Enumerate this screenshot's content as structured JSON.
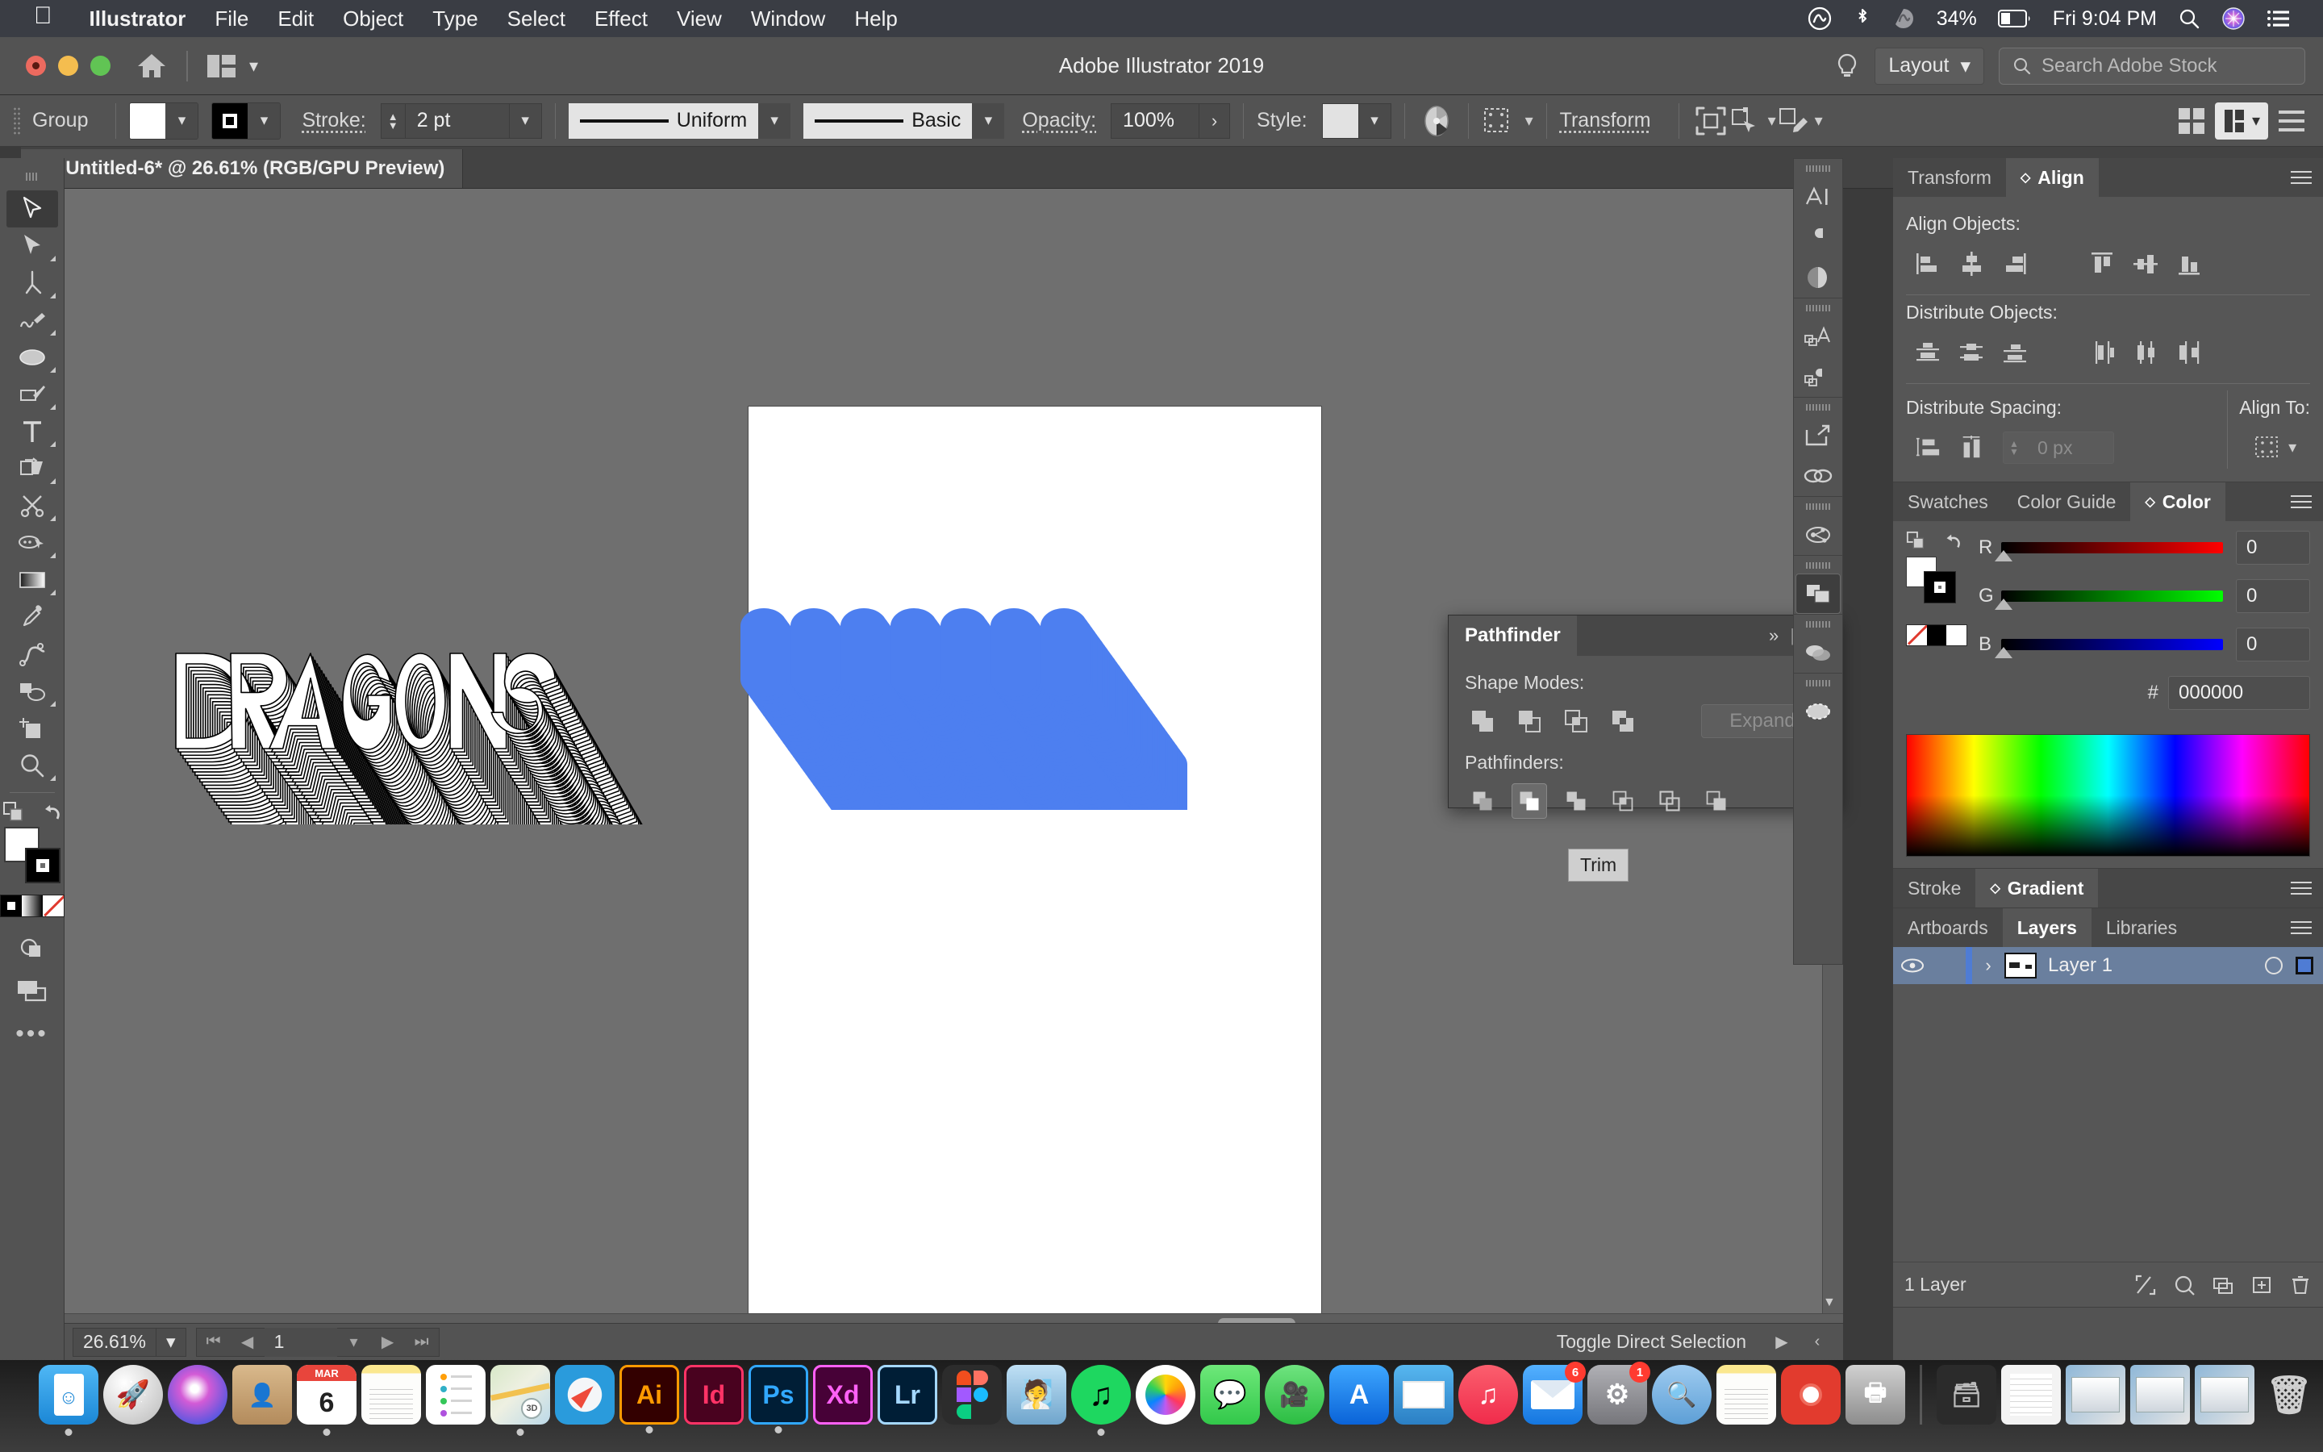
{
  "menubar": {
    "apple_icon": "apple-logo",
    "items": [
      "Illustrator",
      "File",
      "Edit",
      "Object",
      "Type",
      "Select",
      "Effect",
      "View",
      "Window",
      "Help"
    ],
    "status": {
      "creative_cloud_icon": "creative-cloud-icon",
      "bluetooth_icon": "bluetooth-icon",
      "dropbox_icon": "dropbox-icon",
      "battery_percent": "34%",
      "battery_icon": "battery-icon",
      "clock": "Fri 9:04 PM",
      "spotlight_icon": "search-icon",
      "siri_icon": "siri-icon",
      "control_center_icon": "list-icon"
    }
  },
  "titlebar": {
    "title": "Adobe Illustrator 2019",
    "home_icon": "home-icon",
    "arrange_icon": "arrange-documents-icon",
    "bulb_icon": "lightbulb-icon",
    "workspace": "Layout",
    "search_placeholder": "Search Adobe Stock",
    "search_icon": "search-icon"
  },
  "controlbar": {
    "selection_type": "Group",
    "fill_label": "fill-swatch",
    "stroke_label": "stroke-swatch",
    "stroke_text": "Stroke:",
    "stroke_weight": "2 pt",
    "variable_width_profile": "Uniform",
    "brush_definition": "Basic",
    "opacity_label": "Opacity:",
    "opacity_value": "100%",
    "style_label": "Style:",
    "recolor_icon": "recolor-artwork-icon",
    "align_icon": "align-icon",
    "transform_label": "Transform",
    "isolate_icon": "isolate-group-icon",
    "select_similar_icon": "select-similar-icon",
    "edit_toolbar_icon": "edit-toolbar-icon",
    "arrange_docs_icon": "arrange-documents-icon",
    "properties_icon": "properties-icon"
  },
  "documenttab": {
    "close": "×",
    "title": "Untitled-6* @ 26.61% (RGB/GPU Preview)"
  },
  "toolbar": {
    "tools": [
      {
        "name": "selection-tool",
        "active": true
      },
      {
        "name": "direct-selection-tool",
        "active": false
      },
      {
        "name": "pen-tool",
        "active": false
      },
      {
        "name": "curvature-tool",
        "active": false
      },
      {
        "name": "ellipse-tool",
        "active": false
      },
      {
        "name": "paintbrush-tool",
        "active": false
      },
      {
        "name": "type-tool",
        "active": false
      },
      {
        "name": "shape-builder-tool",
        "active": false
      },
      {
        "name": "scissors-tool",
        "active": false
      },
      {
        "name": "width-tool",
        "active": false
      },
      {
        "name": "gradient-tool",
        "active": false
      },
      {
        "name": "eyedropper-tool",
        "active": false
      },
      {
        "name": "blend-tool",
        "active": false
      },
      {
        "name": "symbol-sprayer-tool",
        "active": false
      },
      {
        "name": "artboard-tool",
        "active": false
      },
      {
        "name": "zoom-tool",
        "active": false
      }
    ],
    "swap_fill_stroke_icon": "swap-fill-stroke-icon",
    "default_colors_icon": "default-fill-stroke-icon",
    "color_modes": [
      "color-mode-icon",
      "gradient-mode-icon",
      "none-mode-icon"
    ],
    "drawing_mode_icon": "drawing-mode-icon",
    "screen_mode_icon": "screen-mode-icon",
    "more_tools_icon": "more-tools-icon"
  },
  "pathfinder": {
    "tab": "Pathfinder",
    "collapse_icon": "expand-panel-icon",
    "menu_icon": "panel-menu-icon",
    "shape_modes_label": "Shape Modes:",
    "shape_modes": [
      "unite-icon",
      "minus-front-icon",
      "intersect-icon",
      "exclude-icon"
    ],
    "expand_button": "Expand",
    "pathfinders_label": "Pathfinders:",
    "pathfinders": [
      "divide-icon",
      "trim-icon",
      "merge-icon",
      "crop-icon",
      "outline-icon",
      "minus-back-icon"
    ],
    "selected_pathfinder_index": 1,
    "tooltip": "Trim"
  },
  "icondock": {
    "groups": [
      [
        "character-panel-icon",
        "paragraph-panel-icon",
        "opacity-panel-icon"
      ],
      [
        "character-styles-icon",
        "paragraph-styles-icon"
      ],
      [
        "asset-export-icon",
        "links-panel-icon"
      ],
      [
        "symbols-panel-icon"
      ],
      [
        "pathfinder-panel-icon"
      ],
      [
        "transparency-panel-icon"
      ],
      [
        "image-trace-icon"
      ]
    ],
    "active_icon": "pathfinder-panel-icon"
  },
  "align_panel": {
    "tabs": [
      {
        "label": "Transform",
        "active": false,
        "modified": false
      },
      {
        "label": "Align",
        "active": true,
        "modified": true
      }
    ],
    "align_objects_label": "Align Objects:",
    "align_objects": [
      "align-left-icon",
      "align-horizontal-center-icon",
      "align-right-icon",
      "align-top-icon",
      "align-vertical-center-icon",
      "align-bottom-icon"
    ],
    "distribute_objects_label": "Distribute Objects:",
    "distribute_objects": [
      "distribute-vertical-top-icon",
      "distribute-vertical-center-icon",
      "distribute-vertical-bottom-icon",
      "distribute-horizontal-left-icon",
      "distribute-horizontal-center-icon",
      "distribute-horizontal-right-icon"
    ],
    "distribute_spacing_label": "Distribute Spacing:",
    "distribute_spacing": [
      "distribute-vertical-space-icon",
      "distribute-horizontal-space-icon"
    ],
    "spacing_value": "0 px",
    "align_to_label": "Align To:",
    "align_to_icon": "align-to-selection-icon"
  },
  "color_panel": {
    "tabs": [
      {
        "label": "Swatches",
        "active": false,
        "modified": false
      },
      {
        "label": "Color Guide",
        "active": false,
        "modified": false
      },
      {
        "label": "Color",
        "active": true,
        "modified": true
      }
    ],
    "sliders": [
      {
        "label": "R",
        "value": "0"
      },
      {
        "label": "G",
        "value": "0"
      },
      {
        "label": "B",
        "value": "0"
      }
    ],
    "hex_symbol": "#",
    "hex_value": "000000",
    "swap_icon": "swap-fill-stroke-icon",
    "revert_icon": "revert-arrow-icon"
  },
  "gradient_panel": {
    "tabs": [
      {
        "label": "Stroke",
        "active": false,
        "modified": false
      },
      {
        "label": "Gradient",
        "active": true,
        "modified": true
      }
    ]
  },
  "layers_panel": {
    "tabs": [
      {
        "label": "Artboards",
        "active": false
      },
      {
        "label": "Layers",
        "active": true
      },
      {
        "label": "Libraries",
        "active": false
      }
    ],
    "rows": [
      {
        "eye_icon": "eye-icon",
        "expand_icon": "chevron-right-icon",
        "thumbnail": "layer-thumbnail",
        "name": "Layer 1",
        "target_icon": "target-circle-icon",
        "selected_indicator": "selection-square"
      }
    ],
    "footer_label": "1 Layer",
    "footer_icons": [
      "locate-object-icon",
      "make-clipping-mask-icon",
      "create-sublayer-icon",
      "create-new-layer-icon",
      "delete-selection-icon"
    ]
  },
  "statusbar": {
    "zoom_level": "26.61%",
    "zoom_caret": "chevron-down-icon",
    "first_page_icon": "first-artboard-icon",
    "prev_page_icon": "previous-artboard-icon",
    "page_number": "1",
    "page_caret": "chevron-down-icon",
    "next_page_icon": "next-artboard-icon",
    "last_page_icon": "last-artboard-icon",
    "status_text": "Toggle Direct Selection",
    "status_caret_icon": "play-triangle-icon",
    "status_prev_icon": "chevron-left-icon"
  },
  "canvas": {
    "artwork_left": {
      "name": "dragons-blend-artwork",
      "text": "DRAGONS",
      "fill": "#ffffff",
      "stroke": "#000000"
    },
    "artwork_right": {
      "name": "selected-blue-artwork",
      "fill": "#4d7ff0"
    },
    "artboard_color": "#ffffff",
    "canvas_background": "#6f6f6f"
  },
  "dock": {
    "items": [
      {
        "name": "finder",
        "label": "",
        "color": "#2196f3",
        "kind": "finder"
      },
      {
        "name": "launchpad",
        "label": "",
        "color": "#c6c6c6",
        "kind": "launchpad"
      },
      {
        "name": "siri",
        "label": "",
        "color": "#1a1a2e",
        "kind": "siri"
      },
      {
        "name": "contacts",
        "label": "",
        "color": "#c19a6b",
        "kind": "contacts"
      },
      {
        "name": "calendar",
        "label": "6",
        "color": "#ffffff",
        "kind": "calendar"
      },
      {
        "name": "notes",
        "label": "",
        "color": "#f7e08a",
        "kind": "notes"
      },
      {
        "name": "reminders",
        "label": "",
        "color": "#ffffff",
        "kind": "reminders"
      },
      {
        "name": "maps",
        "label": "",
        "color": "#8fd18f",
        "kind": "maps"
      },
      {
        "name": "safari",
        "label": "",
        "color": "#2a9bdc",
        "kind": "safari"
      },
      {
        "name": "illustrator",
        "label": "Ai",
        "color": "#330000",
        "kind": "adobe",
        "accent": "#ff9a00"
      },
      {
        "name": "indesign",
        "label": "Id",
        "color": "#49021f",
        "kind": "adobe",
        "accent": "#ff3366"
      },
      {
        "name": "photoshop",
        "label": "Ps",
        "color": "#001e36",
        "kind": "adobe",
        "accent": "#31a8ff"
      },
      {
        "name": "adobe-xd",
        "label": "Xd",
        "color": "#470137",
        "kind": "adobe",
        "accent": "#ff61f6"
      },
      {
        "name": "lightroom",
        "label": "Lr",
        "color": "#001e36",
        "kind": "adobe",
        "accent": "#a5d8ff"
      },
      {
        "name": "figma",
        "label": "",
        "color": "#2c2c2c",
        "kind": "figma"
      },
      {
        "name": "procreate",
        "label": "",
        "color": "#8fc5e8",
        "kind": "procreate"
      },
      {
        "name": "spotify",
        "label": "",
        "color": "#1ed760",
        "kind": "spotify"
      },
      {
        "name": "photos",
        "label": "",
        "color": "#ffffff",
        "kind": "photos"
      },
      {
        "name": "messages",
        "label": "",
        "color": "#53d769",
        "kind": "messages"
      },
      {
        "name": "facetime",
        "label": "",
        "color": "#4cd964",
        "kind": "facetime"
      },
      {
        "name": "app-store",
        "label": "",
        "color": "#1f7ef6",
        "kind": "appstore"
      },
      {
        "name": "keynote",
        "label": "",
        "color": "#3d9be9",
        "kind": "keynote"
      },
      {
        "name": "music",
        "label": "",
        "color": "#fa2d48",
        "kind": "music"
      },
      {
        "name": "mail",
        "label": "6",
        "color": "#2d8cf0",
        "kind": "mail"
      },
      {
        "name": "system-preferences",
        "label": "1",
        "color": "#8e8e93",
        "kind": "settings"
      },
      {
        "name": "preview",
        "label": "",
        "color": "#6fa8dc",
        "kind": "preview"
      },
      {
        "name": "stickies",
        "label": "",
        "color": "#f2e394",
        "kind": "stickies"
      },
      {
        "name": "chrome-alt",
        "label": "",
        "color": "#ff3b30",
        "kind": "chromealt"
      },
      {
        "name": "printer",
        "label": "",
        "color": "#b0b0b0",
        "kind": "printer"
      }
    ],
    "right_items": [
      {
        "name": "downloads-stack",
        "kind": "stack"
      },
      {
        "name": "documents-stack",
        "kind": "stack2"
      },
      {
        "name": "screenshot-1",
        "kind": "shot"
      },
      {
        "name": "screenshot-2",
        "kind": "shot2"
      },
      {
        "name": "screenshot-3",
        "kind": "shot3"
      },
      {
        "name": "trash",
        "kind": "trash"
      }
    ]
  }
}
